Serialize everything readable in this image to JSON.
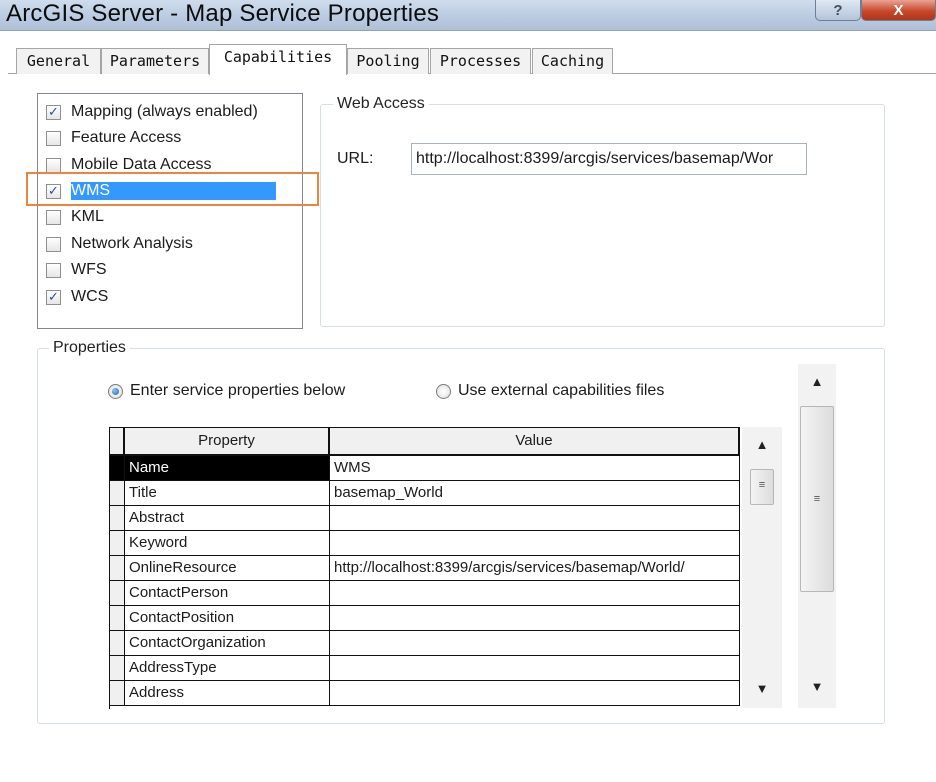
{
  "window": {
    "title": "ArcGIS Server - Map Service Properties",
    "help_label": "?",
    "close_label": "X"
  },
  "tabs": [
    {
      "label": "General"
    },
    {
      "label": "Parameters"
    },
    {
      "label": "Capabilities",
      "active": true
    },
    {
      "label": "Pooling"
    },
    {
      "label": "Processes"
    },
    {
      "label": "Caching"
    }
  ],
  "capabilities": [
    {
      "label": "Mapping (always enabled)",
      "checked": true
    },
    {
      "label": "Feature Access",
      "checked": false
    },
    {
      "label": "Mobile Data Access",
      "checked": false
    },
    {
      "label": "WMS",
      "checked": true,
      "selected": true
    },
    {
      "label": "KML",
      "checked": false
    },
    {
      "label": "Network Analysis",
      "checked": false
    },
    {
      "label": "WFS",
      "checked": false
    },
    {
      "label": "WCS",
      "checked": true
    }
  ],
  "web_access": {
    "legend": "Web Access",
    "url_label": "URL:",
    "url_value": "http://localhost:8399/arcgis/services/basemap/Wor"
  },
  "properties": {
    "legend": "Properties",
    "radio_enter": "Enter service properties below",
    "radio_external": "Use external capabilities files",
    "selected_option": "enter",
    "columns": [
      "Property",
      "Value"
    ],
    "rows": [
      {
        "property": "Name",
        "value": "WMS"
      },
      {
        "property": "Title",
        "value": "basemap_World"
      },
      {
        "property": "Abstract",
        "value": ""
      },
      {
        "property": "Keyword",
        "value": ""
      },
      {
        "property": "OnlineResource",
        "value": "http://localhost:8399/arcgis/services/basemap/World/"
      },
      {
        "property": "ContactPerson",
        "value": ""
      },
      {
        "property": "ContactPosition",
        "value": ""
      },
      {
        "property": "ContactOrganization",
        "value": ""
      },
      {
        "property": "AddressType",
        "value": ""
      },
      {
        "property": "Address",
        "value": ""
      }
    ]
  },
  "icons": {
    "check": "checkmark-icon",
    "scroll_up": "up-arrow-icon",
    "scroll_down": "down-arrow-icon",
    "grip": "scroll-grip-icon"
  },
  "colors": {
    "selection": "#3399ff",
    "highlight_outline": "#e8883f",
    "close_button": "#c7492c"
  }
}
